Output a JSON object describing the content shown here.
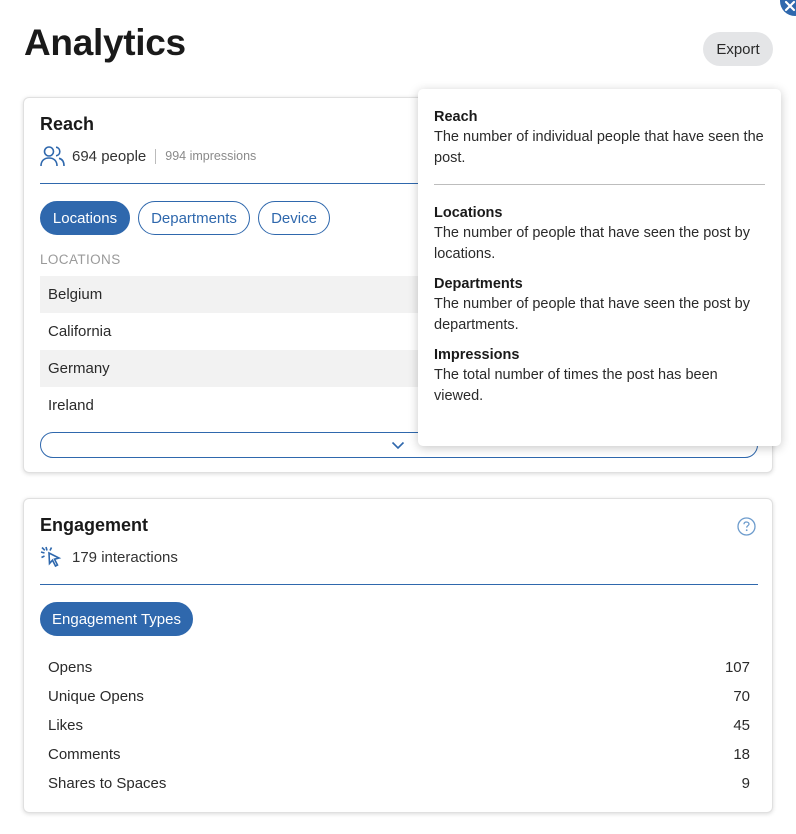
{
  "page": {
    "title": "Analytics",
    "export_label": "Export"
  },
  "reach": {
    "title": "Reach",
    "icon": "people-icon",
    "people": "694 people",
    "impressions": "994 impressions",
    "tabs": [
      {
        "label": "Locations",
        "active": true
      },
      {
        "label": "Departments",
        "active": false
      },
      {
        "label": "Device",
        "active": false
      }
    ],
    "section_label": "LOCATIONS",
    "locations": [
      "Belgium",
      "California",
      "Germany",
      "Ireland"
    ],
    "expand_icon": "chevron-down-icon"
  },
  "engagement": {
    "title": "Engagement",
    "icon": "cursor-click-icon",
    "help_icon": "question-circle-icon",
    "interactions": "179 interactions",
    "tab_label": "Engagement Types",
    "rows": [
      {
        "label": "Opens",
        "value": "107"
      },
      {
        "label": "Unique Opens",
        "value": "70"
      },
      {
        "label": "Likes",
        "value": "45"
      },
      {
        "label": "Comments",
        "value": "18"
      },
      {
        "label": "Shares to Spaces",
        "value": "9"
      }
    ]
  },
  "tooltip": {
    "items": [
      {
        "title": "Reach",
        "body": "The number of individual people that have seen the post."
      },
      {
        "title": "Locations",
        "body": "The number of people that have seen the post by locations."
      },
      {
        "title": "Departments",
        "body": "The number of people that have seen the post by departments."
      },
      {
        "title": "Impressions",
        "body": "The total number of times the post has been viewed."
      }
    ]
  },
  "colors": {
    "accent": "#2f68ad",
    "shaded_row": "#f2f2f2",
    "export_bg": "#e4e5e7"
  }
}
